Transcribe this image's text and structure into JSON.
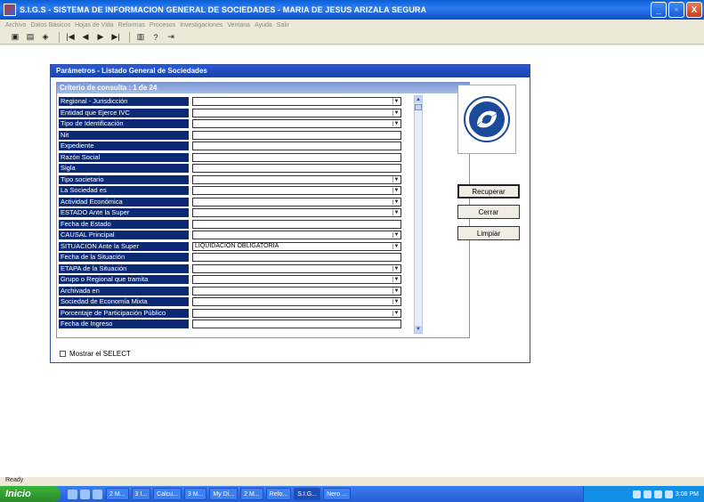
{
  "window": {
    "title": "S.I.G.S  - SISTEMA DE INFORMACION GENERAL DE SOCIEDADES - MARIA DE JESUS ARIZALA SEGURA",
    "min": "_",
    "max": "▫",
    "close": "X"
  },
  "menu": [
    "Archivo",
    "Datos Básicos",
    "Hojas de Vida",
    "Reformas",
    "Procesos",
    "Investigaciones",
    "Ventana",
    "Ayuda",
    "Salir"
  ],
  "toolbar": [
    "▣",
    "▤",
    "◈",
    "|◀",
    "◀",
    "▶",
    "▶|",
    "▥",
    "?",
    "⇥"
  ],
  "dialog": {
    "title": "Parámetros -  Listado General de Sociedades",
    "panel_title": "Criterio de consulta : 1  de  24",
    "rows": [
      {
        "label": "Regional - Jurisdicción",
        "value": "",
        "dropdown": true
      },
      {
        "label": "Entidad que Ejerce IVC",
        "value": "",
        "dropdown": true
      },
      {
        "label": "Tipo de Identificación",
        "value": "",
        "dropdown": true
      },
      {
        "label": "Nit",
        "value": "",
        "dropdown": false
      },
      {
        "label": "Expediente",
        "value": "",
        "dropdown": false
      },
      {
        "label": "Razón Social",
        "value": "",
        "dropdown": false
      },
      {
        "label": "Sigla",
        "value": "",
        "dropdown": false
      },
      {
        "label": "Tipo societario",
        "value": "",
        "dropdown": true
      },
      {
        "label": "La Sociedad es",
        "value": "",
        "dropdown": true
      },
      {
        "label": "Actividad Económica",
        "value": "",
        "dropdown": true
      },
      {
        "label": "ESTADO Ante la Super",
        "value": "",
        "dropdown": true
      },
      {
        "label": "Fecha de Estado",
        "value": "",
        "dropdown": false
      },
      {
        "label": "CAUSAL Principal",
        "value": "",
        "dropdown": true
      },
      {
        "label": "SITUACION Ante la Super",
        "value": "LIQUIDACIÓN OBLIGATORIA",
        "dropdown": true
      },
      {
        "label": "Fecha de la Situación",
        "value": "",
        "dropdown": false
      },
      {
        "label": "ETAPA de la Situación",
        "value": "",
        "dropdown": true
      },
      {
        "label": "Grupo o Regional que tramita",
        "value": "",
        "dropdown": true
      },
      {
        "label": "Archivada en",
        "value": "",
        "dropdown": true
      },
      {
        "label": "Sociedad de Economía Mixta",
        "value": "",
        "dropdown": true
      },
      {
        "label": "Porcentaje de Participación Público",
        "value": "",
        "dropdown": true
      },
      {
        "label": "Fecha de Ingreso",
        "value": "",
        "dropdown": false
      }
    ],
    "buttons": {
      "recuperar": "Recuperar",
      "cerrar": "Cerrar",
      "limpiar": "Limpiar"
    },
    "checkbox_label": "Mostrar el SELECT"
  },
  "status": "Ready",
  "taskbar": {
    "start": "Inicio",
    "tasks": [
      "2 M...",
      "3 I...",
      "Calcu...",
      "3 M...",
      "My Di...",
      "2 M...",
      "Refo...",
      "S.I.G...",
      "Nero ..."
    ],
    "clock": "3:08 PM"
  }
}
